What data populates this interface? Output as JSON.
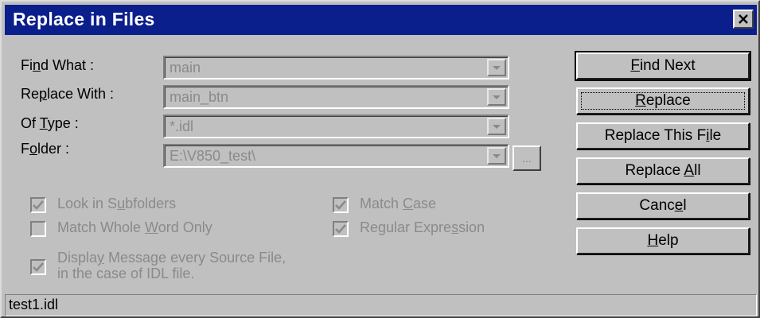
{
  "window": {
    "title": "Replace in Files"
  },
  "fields": {
    "find_what": {
      "label_pre": "Fi",
      "label_acc": "n",
      "label_post": "d What :",
      "value": "main"
    },
    "replace_with": {
      "label_pre": "Re",
      "label_acc": "p",
      "label_post": "lace With :",
      "value": "main_btn"
    },
    "of_type": {
      "label_pre": "Of ",
      "label_acc": "T",
      "label_post": "ype :",
      "value": "*.idl"
    },
    "folder": {
      "label_pre": "F",
      "label_acc": "o",
      "label_post": "lder :",
      "value": "E:\\V850_test\\",
      "browse_label": "..."
    }
  },
  "options": {
    "look_in_subfolders": {
      "pre": "Look in S",
      "acc": "u",
      "post": "bfolders",
      "checked": true
    },
    "match_case": {
      "pre": "Match ",
      "acc": "C",
      "post": "ase",
      "checked": true
    },
    "match_whole_word": {
      "pre": "Match Whole ",
      "acc": "W",
      "post": "ord Only",
      "checked": false
    },
    "regular_expression": {
      "pre": "Regular Expre",
      "acc": "s",
      "post": "sion",
      "checked": true
    },
    "display_message": {
      "pre": "Displa",
      "acc": "y",
      "post": " Message every Source File,",
      "line2": "in the case of IDL file.",
      "checked": true
    }
  },
  "buttons": {
    "find_next": {
      "pre": "",
      "acc": "F",
      "post": "ind Next"
    },
    "replace": {
      "pre": "",
      "acc": "R",
      "post": "eplace"
    },
    "replace_this_file": {
      "pre": "Replace This F",
      "acc": "i",
      "post": "le"
    },
    "replace_all": {
      "pre": "Replace ",
      "acc": "A",
      "post": "ll"
    },
    "cancel": {
      "pre": "Canc",
      "acc": "e",
      "post": "l"
    },
    "help": {
      "pre": "",
      "acc": "H",
      "post": "elp"
    }
  },
  "status": {
    "text": "test1.idl"
  },
  "colors": {
    "titlebar": "#0a1e8c",
    "face": "#c0c0c0",
    "disabled_text": "#8a8a8a"
  },
  "icons": {
    "close": "close-icon",
    "dropdown": "chevron-down-icon",
    "check": "checkmark-icon"
  }
}
